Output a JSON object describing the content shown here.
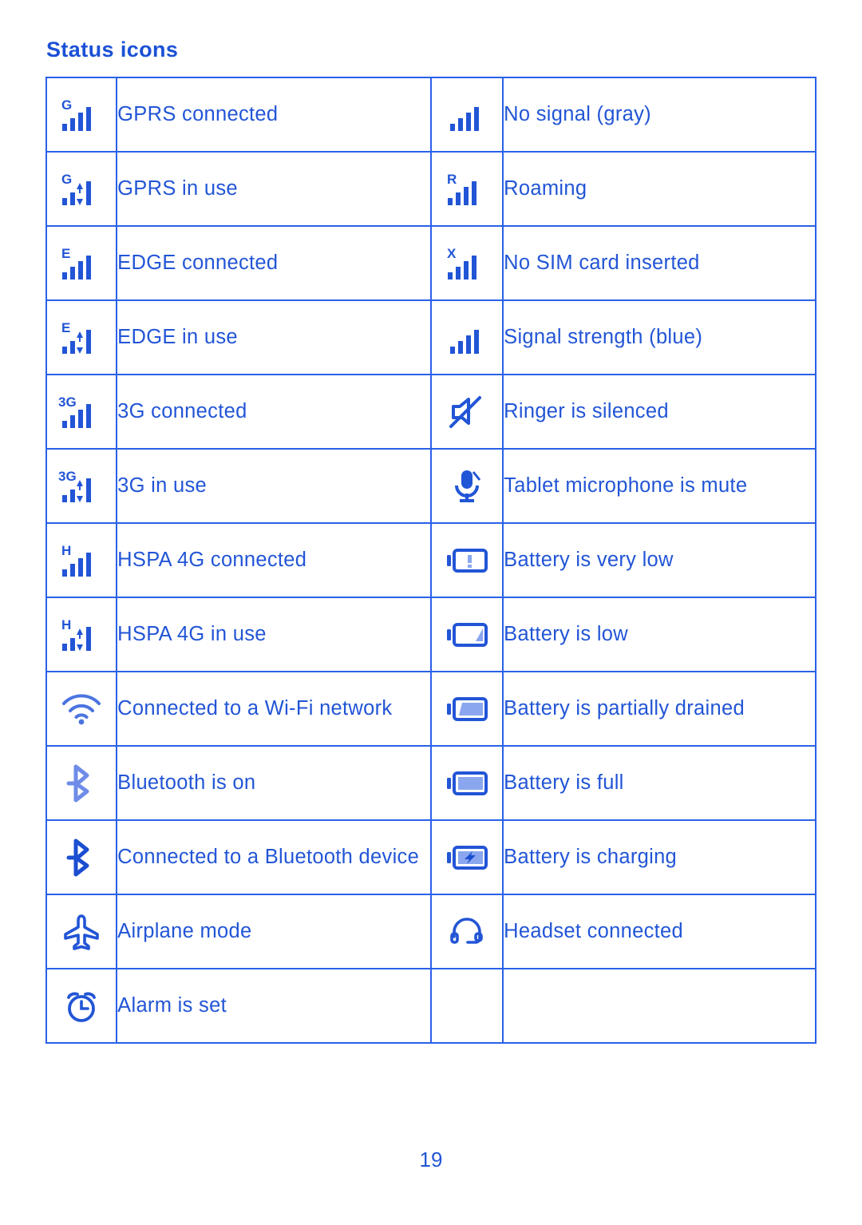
{
  "page": {
    "title": "Status icons",
    "page_number": "19",
    "accent_color": "#2255d6",
    "border_color": "#2a61e8",
    "bluetooth_on_color": "#6e8ce8"
  },
  "table": {
    "left_column": [
      {
        "icon": "signal-gprs-connected-icon",
        "badge": "G",
        "label": "GPRS connected"
      },
      {
        "icon": "signal-gprs-in-use-icon",
        "badge": "G",
        "label": "GPRS in use"
      },
      {
        "icon": "signal-edge-connected-icon",
        "badge": "E",
        "label": "EDGE connected"
      },
      {
        "icon": "signal-edge-in-use-icon",
        "badge": "E",
        "label": "EDGE in use"
      },
      {
        "icon": "signal-3g-connected-icon",
        "badge": "3G",
        "label": "3G connected"
      },
      {
        "icon": "signal-3g-in-use-icon",
        "badge": "3G",
        "label": "3G in use"
      },
      {
        "icon": "signal-hspa-connected-icon",
        "badge": "H",
        "label": "HSPA 4G connected"
      },
      {
        "icon": "signal-hspa-in-use-icon",
        "badge": "H",
        "label": "HSPA 4G in use"
      },
      {
        "icon": "wifi-icon",
        "badge": "",
        "label": "Connected to a Wi-Fi network"
      },
      {
        "icon": "bluetooth-on-icon",
        "badge": "",
        "label": "Bluetooth is on"
      },
      {
        "icon": "bluetooth-connected-icon",
        "badge": "",
        "label": "Connected to a Bluetooth device"
      },
      {
        "icon": "airplane-icon",
        "badge": "",
        "label": "Airplane mode"
      },
      {
        "icon": "alarm-clock-icon",
        "badge": "",
        "label": "Alarm is set"
      }
    ],
    "right_column": [
      {
        "icon": "signal-no-signal-icon",
        "badge": "",
        "label": "No signal (gray)"
      },
      {
        "icon": "signal-roaming-icon",
        "badge": "R",
        "label": "Roaming"
      },
      {
        "icon": "signal-no-sim-icon",
        "badge": "X",
        "label": "No SIM card inserted"
      },
      {
        "icon": "signal-strength-icon",
        "badge": "",
        "label": "Signal strength (blue)"
      },
      {
        "icon": "ringer-silenced-icon",
        "badge": "",
        "label": "Ringer is silenced"
      },
      {
        "icon": "microphone-mute-icon",
        "badge": "",
        "label": "Tablet microphone is mute"
      },
      {
        "icon": "battery-very-low-icon",
        "badge": "",
        "label": "Battery is very low"
      },
      {
        "icon": "battery-low-icon",
        "badge": "",
        "label": "Battery is low"
      },
      {
        "icon": "battery-partial-icon",
        "badge": "",
        "label": "Battery is partially drained"
      },
      {
        "icon": "battery-full-icon",
        "badge": "",
        "label": "Battery is full"
      },
      {
        "icon": "battery-charging-icon",
        "badge": "",
        "label": "Battery is charging"
      },
      {
        "icon": "headset-icon",
        "badge": "",
        "label": "Headset connected"
      },
      {
        "icon": "",
        "badge": "",
        "label": ""
      }
    ]
  }
}
